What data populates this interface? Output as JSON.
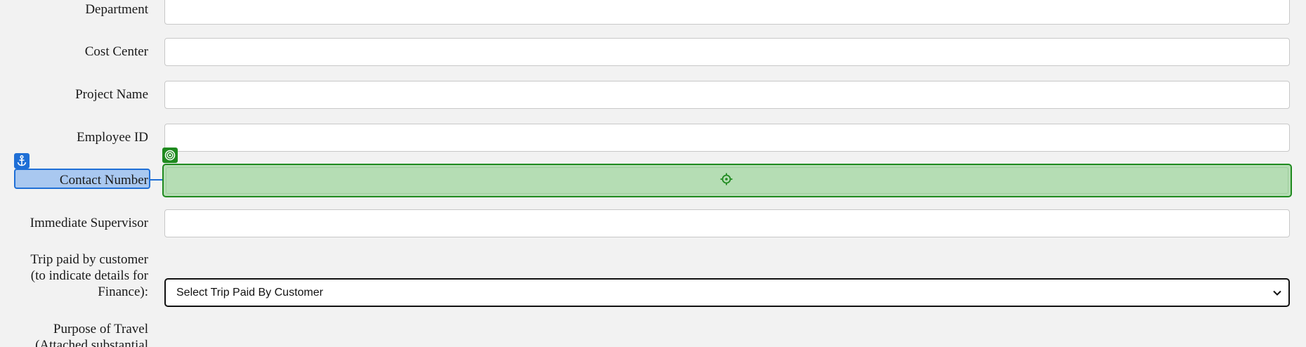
{
  "form": {
    "fields": [
      {
        "label": "Department",
        "value": ""
      },
      {
        "label": "Cost Center",
        "value": ""
      },
      {
        "label": "Project Name",
        "value": ""
      },
      {
        "label": "Employee ID",
        "value": ""
      },
      {
        "label": "Contact Number",
        "value": ""
      },
      {
        "label": "Immediate Supervisor",
        "value": ""
      }
    ],
    "trip_paid": {
      "label_lines": [
        "Trip paid by customer",
        "(to indicate details for",
        "Finance):"
      ],
      "selected": "Select Trip Paid By Customer"
    },
    "purpose": {
      "label_lines": [
        "Purpose of Travel",
        "(Attached substantial"
      ]
    }
  },
  "overlay": {
    "label_color": "#1f6fd6",
    "field_color": "#1f8a1f",
    "label_badge_icon": "anchor-icon",
    "field_badge_icon": "target-ring-icon",
    "field_center_icon": "crosshair-icon"
  }
}
